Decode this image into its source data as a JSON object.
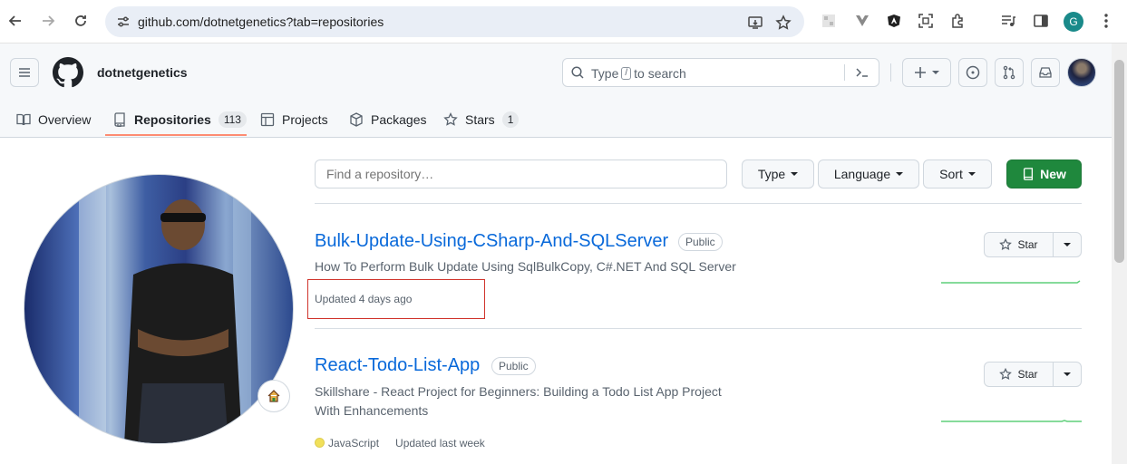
{
  "browser": {
    "url": "github.com/dotnetgenetics?tab=repositories",
    "profile_initial": "G"
  },
  "header": {
    "username": "dotnetgenetics",
    "search_prefix": "Type",
    "search_key": "/",
    "search_suffix": "to search"
  },
  "tabs": [
    {
      "label": "Overview"
    },
    {
      "label": "Repositories",
      "count": "113"
    },
    {
      "label": "Projects"
    },
    {
      "label": "Packages"
    },
    {
      "label": "Stars",
      "count": "1"
    }
  ],
  "filters": {
    "find_placeholder": "Find a repository…",
    "type_label": "Type",
    "language_label": "Language",
    "sort_label": "Sort",
    "new_label": "New"
  },
  "repos": [
    {
      "name": "Bulk-Update-Using-CSharp-And-SQLServer",
      "visibility": "Public",
      "description": "How To Perform Bulk Update Using SqlBulkCopy, C#.NET And SQL Server",
      "updated": "Updated 4 days ago",
      "star_label": "Star"
    },
    {
      "name": "React-Todo-List-App",
      "visibility": "Public",
      "description_line1": "Skillshare - React Project for Beginners: Building a Todo List App Project",
      "description_line2": "With Enhancements",
      "language": "JavaScript",
      "language_color": "#f1e05a",
      "updated": "Updated last week",
      "star_label": "Star"
    }
  ],
  "colors": {
    "accent_link": "#0969da",
    "new_button": "#1f883d",
    "tab_underline": "#fd8c73",
    "highlight": "#d0342c"
  }
}
